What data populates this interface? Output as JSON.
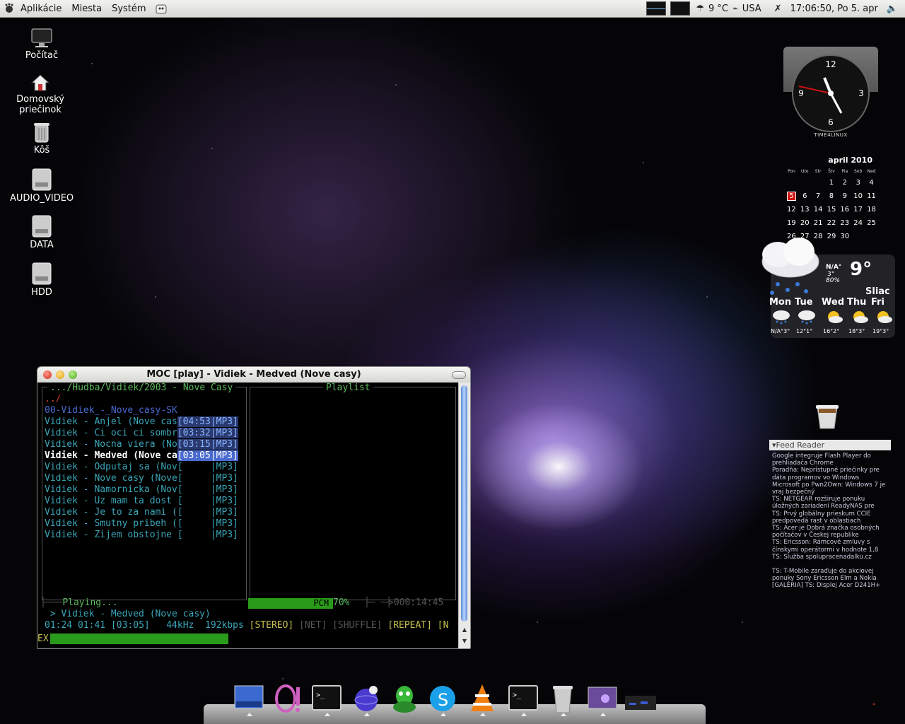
{
  "top_panel": {
    "menu": [
      "Aplikácie",
      "Miesta",
      "Systém"
    ],
    "weather_text": "9 °C",
    "keyboard_layout": "USA",
    "datetime": "17:06:50, Po  5. apr"
  },
  "desktop_icons": [
    {
      "label": "Počítač",
      "icon": "computer-icon"
    },
    {
      "label": "Domovský\nprie­činok",
      "icon": "home-folder-icon"
    },
    {
      "label": "Kôš",
      "icon": "trash-icon"
    },
    {
      "label": "AUDIO_VIDEO",
      "icon": "drive-icon"
    },
    {
      "label": "DATA",
      "icon": "drive-icon"
    },
    {
      "label": "HDD",
      "icon": "drive-icon"
    }
  ],
  "clock": {
    "numbers": [
      "12",
      "3",
      "6",
      "9"
    ],
    "brand": "TIME4LINUX"
  },
  "calendar": {
    "title": "april 2010",
    "weekdays": [
      "Pon",
      "Uto",
      "Str",
      "Štv",
      "Pia",
      "Sob",
      "Ned"
    ],
    "weeks": [
      [
        "",
        "",
        "",
        "1",
        "2",
        "3",
        "4"
      ],
      [
        "5",
        "6",
        "7",
        "8",
        "9",
        "10",
        "11"
      ],
      [
        "12",
        "13",
        "14",
        "15",
        "16",
        "17",
        "18"
      ],
      [
        "19",
        "20",
        "21",
        "22",
        "23",
        "24",
        "25"
      ],
      [
        "26",
        "27",
        "28",
        "29",
        "30",
        "",
        ""
      ]
    ],
    "today": "5"
  },
  "weather": {
    "current_temp": "9°",
    "hi": "N/A°",
    "lo": "3°",
    "humidity": "80%",
    "city": "Sliac",
    "forecast": [
      {
        "day": "Mon",
        "temps": "N/A°3°"
      },
      {
        "day": "Tue",
        "temps": "12°1°"
      },
      {
        "day": "Wed",
        "temps": "16°2°"
      },
      {
        "day": "Thu",
        "temps": "18°3°"
      },
      {
        "day": "Fri",
        "temps": "19°3°"
      }
    ]
  },
  "feed_reader": {
    "title": "▾Feed Reader",
    "items": [
      "Google integruje Flash Player do prehliadača Chrome",
      "Poradňa: Neprístupné priečinky pre dáta programov vo Windows",
      "Microsoft po Pwn2Own: Windows 7 je vraj bezpečný",
      "TS: NETGEAR rozširuje ponuku úložných zariadení ReadyNAS pre",
      "TS: Prvý globálny prieskum CCIE predpovedá rast v oblastiach",
      "TS: Acer je Dobrá značka osobných počítačov v Českej republike",
      "TS: Ericsson: Rámcové zmluvy s čínskymi operátormi v hodnote 1,8",
      "TS: Služba spolupracenadalku.cz",
      "TS: T-Mobile zaraďuje do akciovej ponuky Sony Ericsson Elm a Nokia",
      "[GALÉRIA] TS: Displej Acer D241H+"
    ]
  },
  "moc": {
    "window_title": "MOC [play] - Vidiek - Medved (Nove casy)",
    "dir_title": ".../Hudba/Vidiek/2003 - Nove Casy",
    "playlist_title": "Playlist",
    "parent_dir": "../",
    "folder": "00-Vidiek_-_Nove_casy-SK",
    "files": [
      {
        "name": "Vidiek - Anjel (Nove cas",
        "time": "04:53",
        "fmt": "MP3"
      },
      {
        "name": "Vidiek - Ci oci ci sombr",
        "time": "03:32",
        "fmt": "MP3"
      },
      {
        "name": "Vidiek - Nocna viera (No",
        "time": "03:15",
        "fmt": "MP3"
      },
      {
        "name": "Vidiek - Medved (Nove ca",
        "time": "03:05",
        "fmt": "MP3"
      },
      {
        "name": "Vidiek - Odputaj sa (Nov",
        "time": "",
        "fmt": "MP3"
      },
      {
        "name": "Vidiek - Nove casy (Nove",
        "time": "",
        "fmt": "MP3"
      },
      {
        "name": "Vidiek - Namornicka (Nov",
        "time": "",
        "fmt": "MP3"
      },
      {
        "name": "Vidiek - Uz mam ta dost ",
        "time": "",
        "fmt": "MP3"
      },
      {
        "name": "Vidiek - Je to za nami (",
        "time": "",
        "fmt": "MP3"
      },
      {
        "name": "Vidiek - Smutny pribeh (",
        "time": "",
        "fmt": "MP3"
      },
      {
        "name": "Vidiek - Zijem obstojne ",
        "time": "",
        "fmt": "MP3"
      }
    ],
    "current_index": 3,
    "status": "Playing...",
    "mixer": "PCM",
    "volume": "70%",
    "total_time": ">000:14:45",
    "now_playing": " > Vidiek - Medved (Nove casy)",
    "time_elapsed": "01:24",
    "time_left": "01:41",
    "time_total": "[03:05]",
    "rate": "44kHz",
    "bitrate": "192kbps",
    "flags": {
      "stereo": "[STEREO]",
      "net": "[NET]",
      "shuffle": "[SHUFFLE]",
      "repeat": "[REPEAT]",
      "next": "[N"
    },
    "ex": "EX",
    "progress_fraction": 0.45,
    "volume_fraction": 0.7
  },
  "dock": [
    "desktop-preview-icon",
    "media-player-icon",
    "terminal-icon",
    "internet-browser-icon",
    "messenger-icon",
    "skype-icon",
    "vlc-icon",
    "terminal-icon",
    "trash-icon",
    "image-viewer-icon",
    "screen-icon"
  ]
}
